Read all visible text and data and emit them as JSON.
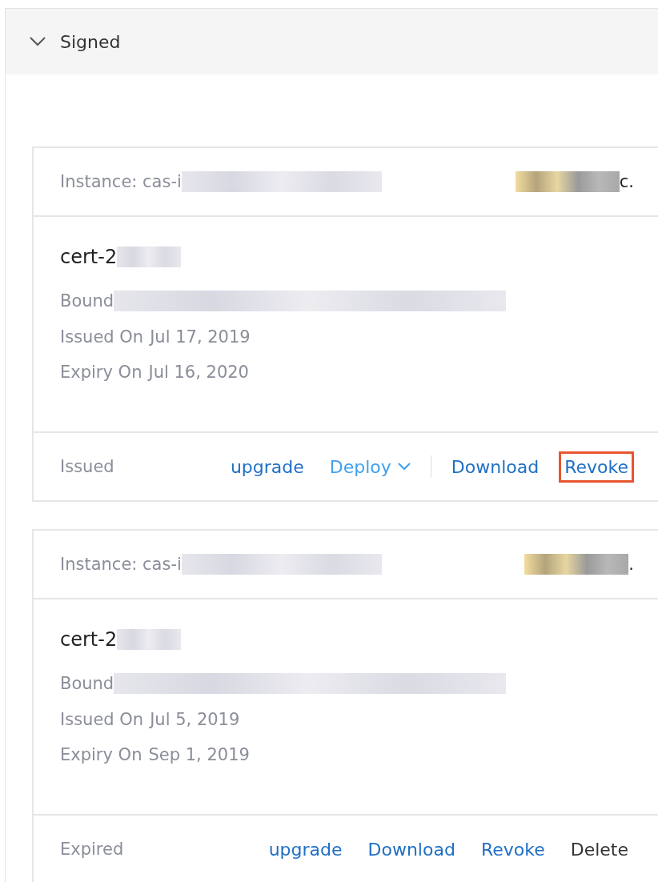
{
  "section": {
    "title": "Signed",
    "expanded": true
  },
  "cards": [
    {
      "instance": "Instance: cas-i",
      "instance_end": "c.",
      "name": "cert-2",
      "bound": "Bound",
      "issued_label": "Issued On",
      "issued": "Jul 17, 2019",
      "expiry_label": "Expiry On",
      "expiry": "Jul 16, 2020",
      "status": "Issued",
      "actions": [
        {
          "label": "upgrade",
          "kind": "link",
          "highlighted": false
        },
        {
          "label": "Deploy",
          "kind": "dropdown",
          "highlighted": false
        },
        {
          "label": "Download",
          "kind": "link",
          "highlighted": false
        },
        {
          "label": "Revoke",
          "kind": "link",
          "highlighted": true
        }
      ]
    },
    {
      "instance": "Instance: cas-i",
      "instance_end": ".",
      "name": "cert-2",
      "bound": "Bound",
      "issued_label": "Issued On",
      "issued": "Jul 5, 2019",
      "expiry_label": "Expiry On",
      "expiry": "Sep 1, 2019",
      "status": "Expired",
      "actions": [
        {
          "label": "upgrade",
          "kind": "link",
          "highlighted": false
        },
        {
          "label": "Download",
          "kind": "link",
          "highlighted": false
        },
        {
          "label": "Revoke",
          "kind": "link",
          "highlighted": false
        },
        {
          "label": "Delete",
          "kind": "plain",
          "highlighted": false
        }
      ]
    }
  ]
}
